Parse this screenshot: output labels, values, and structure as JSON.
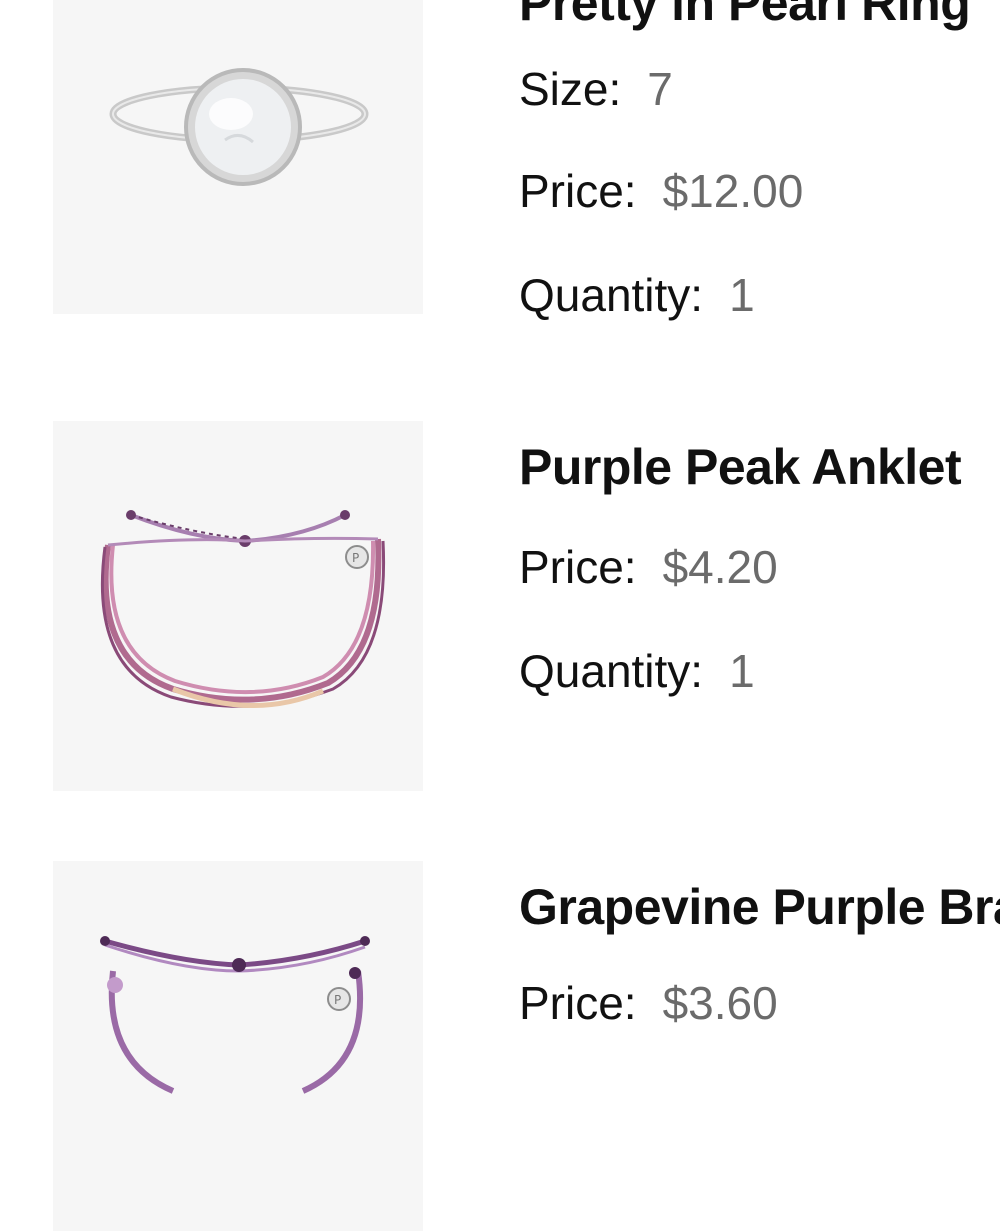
{
  "cart": {
    "items": [
      {
        "title": "Pretty in Pearl Ring",
        "image": "pearl-ring-image",
        "size_label": "Size:",
        "size_value": "7",
        "price_label": "Price:",
        "price_value": "$12.00",
        "quantity_label": "Quantity:",
        "quantity_value": "1"
      },
      {
        "title": "Purple Peak Anklet",
        "image": "purple-anklet-image",
        "price_label": "Price:",
        "price_value": "$4.20",
        "quantity_label": "Quantity:",
        "quantity_value": "1"
      },
      {
        "title": "Grapevine Purple Brac",
        "image": "grapevine-bracelet-image",
        "price_label": "Price:",
        "price_value": "$3.60"
      }
    ]
  },
  "colors": {
    "thumb_bg": "#f6f6f6",
    "value_gray": "#6b6b6b",
    "cord_purple": "#a06a9a",
    "cord_dark": "#6a3d6a"
  }
}
